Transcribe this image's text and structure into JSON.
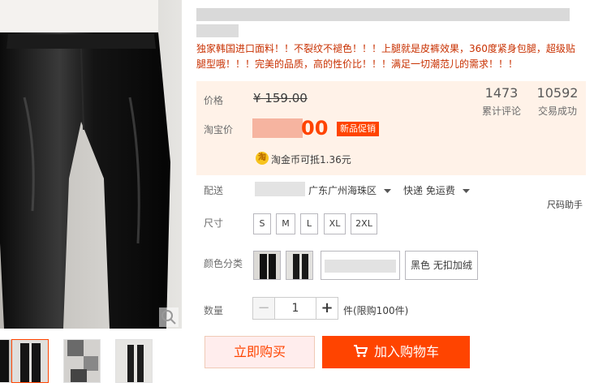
{
  "product": {
    "description": "独家韩国进口面料！！不裂纹不褪色！！！上腿就是皮裤效果，360度紧身包腿，超级贴腿型哦！！！完美的品质，高的性价比！！！满足一切潮范儿的需求！！！"
  },
  "price": {
    "label": "价格",
    "original": "¥ 159.00",
    "taobao_label": "淘宝价",
    "promo_visible_suffix": "00",
    "promo_tag": "新品促销"
  },
  "stats": {
    "reviews_count": "1473",
    "reviews_label": "累计评论",
    "sold_count": "10592",
    "sold_label": "交易成功"
  },
  "coin": {
    "icon_char": "淘",
    "text": "淘金币可抵1.36元"
  },
  "shipping": {
    "label": "配送",
    "destination": "广东广州海珠区",
    "method": "快递 免运费",
    "size_helper": "尺码助手"
  },
  "sizes": {
    "label": "尺寸",
    "options": [
      "S",
      "M",
      "L",
      "XL",
      "2XL"
    ]
  },
  "colors": {
    "label": "颜色分类",
    "text_option": "黑色 无扣加绒"
  },
  "quantity": {
    "label": "数量",
    "minus": "−",
    "value": "1",
    "plus": "+",
    "limit_text": "件(限购100件)"
  },
  "buttons": {
    "buy_now": "立即购买",
    "add_to_cart": "加入购物车"
  },
  "colors_theme": {
    "accent": "#ff4400",
    "price_box_bg": "#fff2e8",
    "buy_now_bg": "#ffeded"
  },
  "icons": {
    "zoom": "search-icon",
    "cart": "cart-icon",
    "dropdown": "caret-down-icon"
  }
}
